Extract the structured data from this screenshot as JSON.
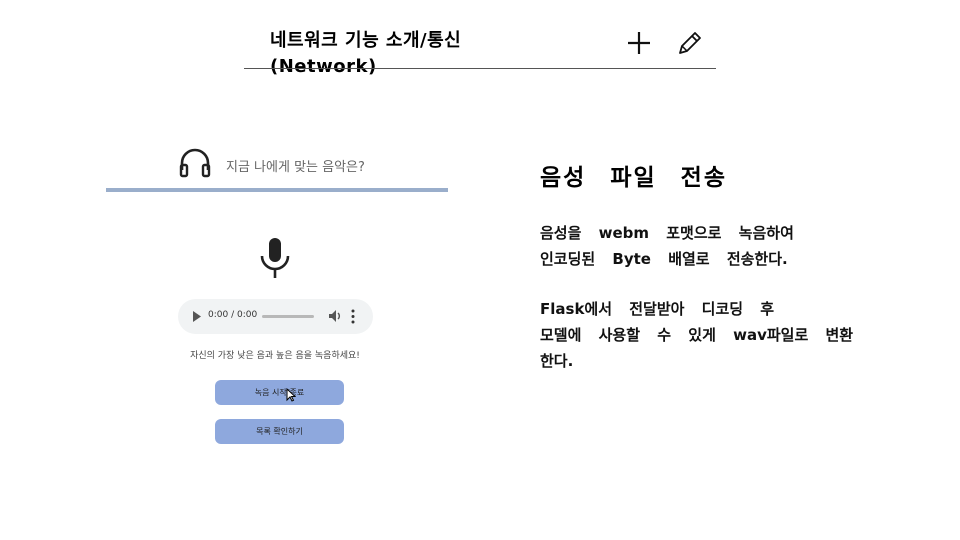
{
  "slide": {
    "title_line1": "네트워크 기능 소개/통신",
    "title_line2": "(Network)",
    "add_icon": "plus-icon",
    "edit_icon": "pencil-icon"
  },
  "demo": {
    "header_icon": "headphones-icon",
    "title": "지금 나에게 맞는 음악은?",
    "mic_icon": "microphone-icon",
    "audio": {
      "time": "0:00 / 0:00",
      "progress": 0
    },
    "hint": "자신의 가장 낮은 음과 높은 음을 녹음하세요!",
    "record_button": "녹음 시작/종료",
    "list_button": "목록 확인하기",
    "accent_color": "#8ea8dd"
  },
  "content": {
    "heading": "음성 파일 전송",
    "para1_line1": "음성을 webm 포맷으로 녹음하여",
    "para1_line2": "인코딩된 Byte 배열로 전송한다.",
    "para2_line1": "Flask에서 전달받아 디코딩 후",
    "para2_line2": "모델에 사용할 수 있게 wav파일로 변환",
    "para2_line3": "한다."
  }
}
